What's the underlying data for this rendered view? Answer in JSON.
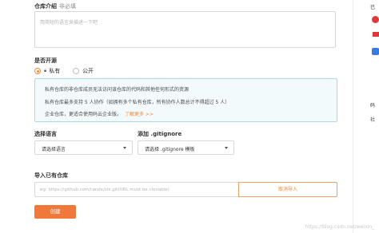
{
  "description_section": {
    "label": "仓库介绍",
    "sublabel": "非必填",
    "placeholder": "用简短的语言来描述一下吧"
  },
  "visibility": {
    "label": "是否开源",
    "options": [
      {
        "label": "私有",
        "icon": "lock-icon",
        "selected": true
      },
      {
        "label": "公开",
        "icon": "",
        "selected": false
      }
    ],
    "info_lines": [
      "私有仓库的非仓库成员无法访问该仓库的代码和其他任何形式的资源",
      "私有仓库最多支持 5 人协作（如拥有多个私有仓库，所有协作人数总计不得超过 5 人）",
      "企业仓库，更适合使用码云企业版。"
    ],
    "learn_more": "了解更多 >>"
  },
  "language": {
    "label": "选择语言",
    "value": "请选择语言"
  },
  "gitignore": {
    "label": "添加 .gitignore",
    "value": "请选择 .gitignore 模板"
  },
  "import": {
    "label": "导入已有仓库",
    "placeholder": "eg: https://github.com/randx/six.git(URL must be clonable)",
    "cancel_label": "取消导入"
  },
  "create_button": "创建",
  "watermark": "https://blog.csdn.net/weixin_",
  "side_panel": {
    "t1": "已",
    "t2": "码",
    "t3": "社"
  },
  "colors": {
    "accent": "#f0883a",
    "info_border": "#a9dbe0",
    "info_bg": "#f2fafb"
  }
}
